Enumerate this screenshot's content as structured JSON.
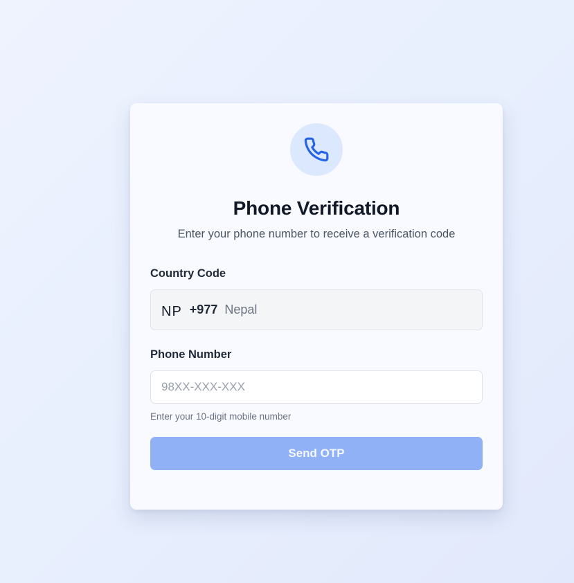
{
  "header": {
    "icon": "phone-icon",
    "title": "Phone Verification",
    "subtitle": "Enter your phone number to receive a verification code"
  },
  "country": {
    "label": "Country Code",
    "flag_code": "NP",
    "dial_code": "+977",
    "name": "Nepal"
  },
  "phone": {
    "label": "Phone Number",
    "value": "",
    "placeholder": "98XX-XXX-XXX",
    "hint": "Enter your 10-digit mobile number"
  },
  "actions": {
    "send_label": "Send OTP"
  },
  "colors": {
    "accent": "#2563eb",
    "icon_bg": "#dbe8fd",
    "button_disabled": "#91b1f6",
    "card_bg": "#f8faff"
  }
}
